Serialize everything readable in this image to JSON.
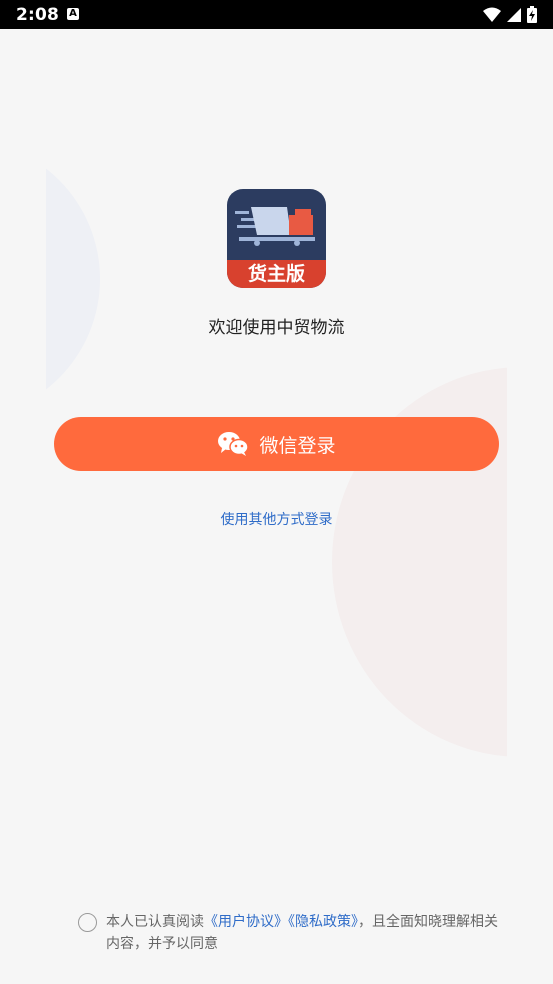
{
  "status_bar": {
    "time": "2:08",
    "notif_letter": "A"
  },
  "app": {
    "logo_badge_text": "货主版",
    "welcome_text": "欢迎使用中贸物流"
  },
  "login": {
    "wechat_button_label": "微信登录",
    "other_login_label": "使用其他方式登录"
  },
  "agreement": {
    "prefix": "本人已认真阅读",
    "user_agreement": "《用户协议》",
    "privacy_policy": "《隐私政策》",
    "suffix": "，且全面知晓理解相关内容，并予以同意"
  },
  "colors": {
    "primary_button": "#ff6a3d",
    "link": "#2f6cc8",
    "logo_bg": "#2c3c60",
    "logo_badge": "#d8412e"
  }
}
